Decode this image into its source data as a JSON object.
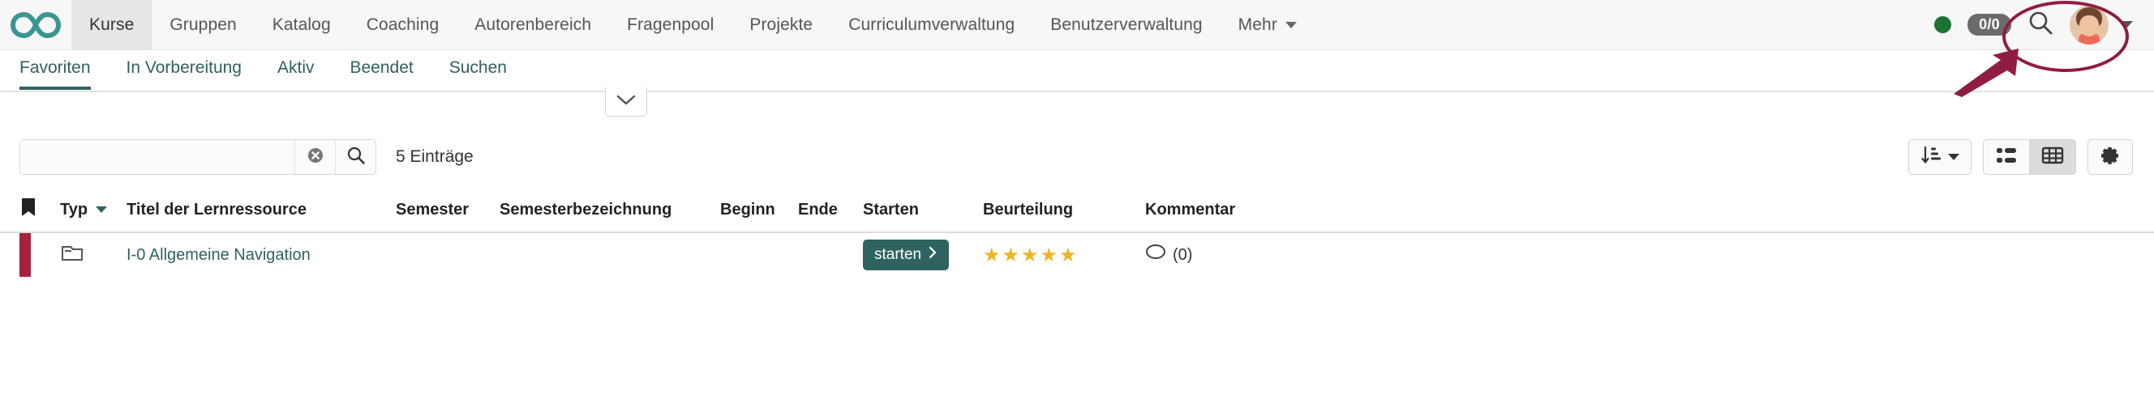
{
  "header": {
    "logo_icon": "infinity-logo",
    "nav": [
      {
        "label": "Kurse",
        "active": true
      },
      {
        "label": "Gruppen",
        "active": false
      },
      {
        "label": "Katalog",
        "active": false
      },
      {
        "label": "Coaching",
        "active": false
      },
      {
        "label": "Autorenbereich",
        "active": false
      },
      {
        "label": "Fragenpool",
        "active": false
      },
      {
        "label": "Projekte",
        "active": false
      },
      {
        "label": "Curriculumverwaltung",
        "active": false
      },
      {
        "label": "Benutzerverwaltung",
        "active": false
      },
      {
        "label": "Mehr",
        "active": false,
        "has_caret": true
      }
    ],
    "status_dot_color": "#1c7430",
    "count_badge": "0/0",
    "search_icon": "search-icon",
    "avatar_icon": "user-avatar",
    "avatar_caret_icon": "chevron-down-icon"
  },
  "annotation": {
    "highlight_color": "#8f1d41",
    "shape": "ellipse-around-avatar",
    "arrow": "arrow-pointing-to-avatar"
  },
  "tabs": [
    {
      "label": "Favoriten",
      "active": true
    },
    {
      "label": "In Vorbereitung",
      "active": false
    },
    {
      "label": "Aktiv",
      "active": false
    },
    {
      "label": "Beendet",
      "active": false
    },
    {
      "label": "Suchen",
      "active": false
    }
  ],
  "collapse_toggle": {
    "icon": "chevron-down-icon"
  },
  "toolbar": {
    "search_value": "",
    "search_placeholder": "",
    "clear_icon": "clear-circle-icon",
    "search_icon": "search-icon",
    "entries_label": "5 Einträge",
    "sort_button": {
      "icon": "sort-descending-icon",
      "caret": "chevron-down-icon"
    },
    "view_list": {
      "icon": "list-view-icon",
      "active": false
    },
    "view_table": {
      "icon": "table-view-icon",
      "active": true
    },
    "settings_button": {
      "icon": "gear-icon"
    }
  },
  "table": {
    "columns": [
      {
        "key": "bookmark",
        "label": "",
        "icon": "bookmark-icon"
      },
      {
        "key": "typ",
        "label": "Typ",
        "sortable": true
      },
      {
        "key": "titel",
        "label": "Titel der Lernressource"
      },
      {
        "key": "semester",
        "label": "Semester"
      },
      {
        "key": "semesterbezeichnung",
        "label": "Semesterbezeichnung"
      },
      {
        "key": "beginn",
        "label": "Beginn"
      },
      {
        "key": "ende",
        "label": "Ende"
      },
      {
        "key": "starten",
        "label": "Starten"
      },
      {
        "key": "beurteilung",
        "label": "Beurteilung"
      },
      {
        "key": "kommentar",
        "label": "Kommentar"
      }
    ],
    "rows": [
      {
        "typ_icon": "course-icon",
        "titel": "I-0 Allgemeine Navigation",
        "semester": "",
        "semesterbezeichnung": "",
        "beginn": "",
        "ende": "",
        "start_label": "starten",
        "start_icon": "chevron-right-icon",
        "rating": 5,
        "rating_max": 5,
        "kommentar": "(0)",
        "kommentar_icon": "comment-bubble-icon"
      }
    ]
  },
  "colors": {
    "brand_teal": "#3a9690",
    "tab_teal": "#31605e",
    "accent_red": "#8f1d41",
    "star_gold": "#f0b323",
    "green_dot": "#1c7430"
  }
}
